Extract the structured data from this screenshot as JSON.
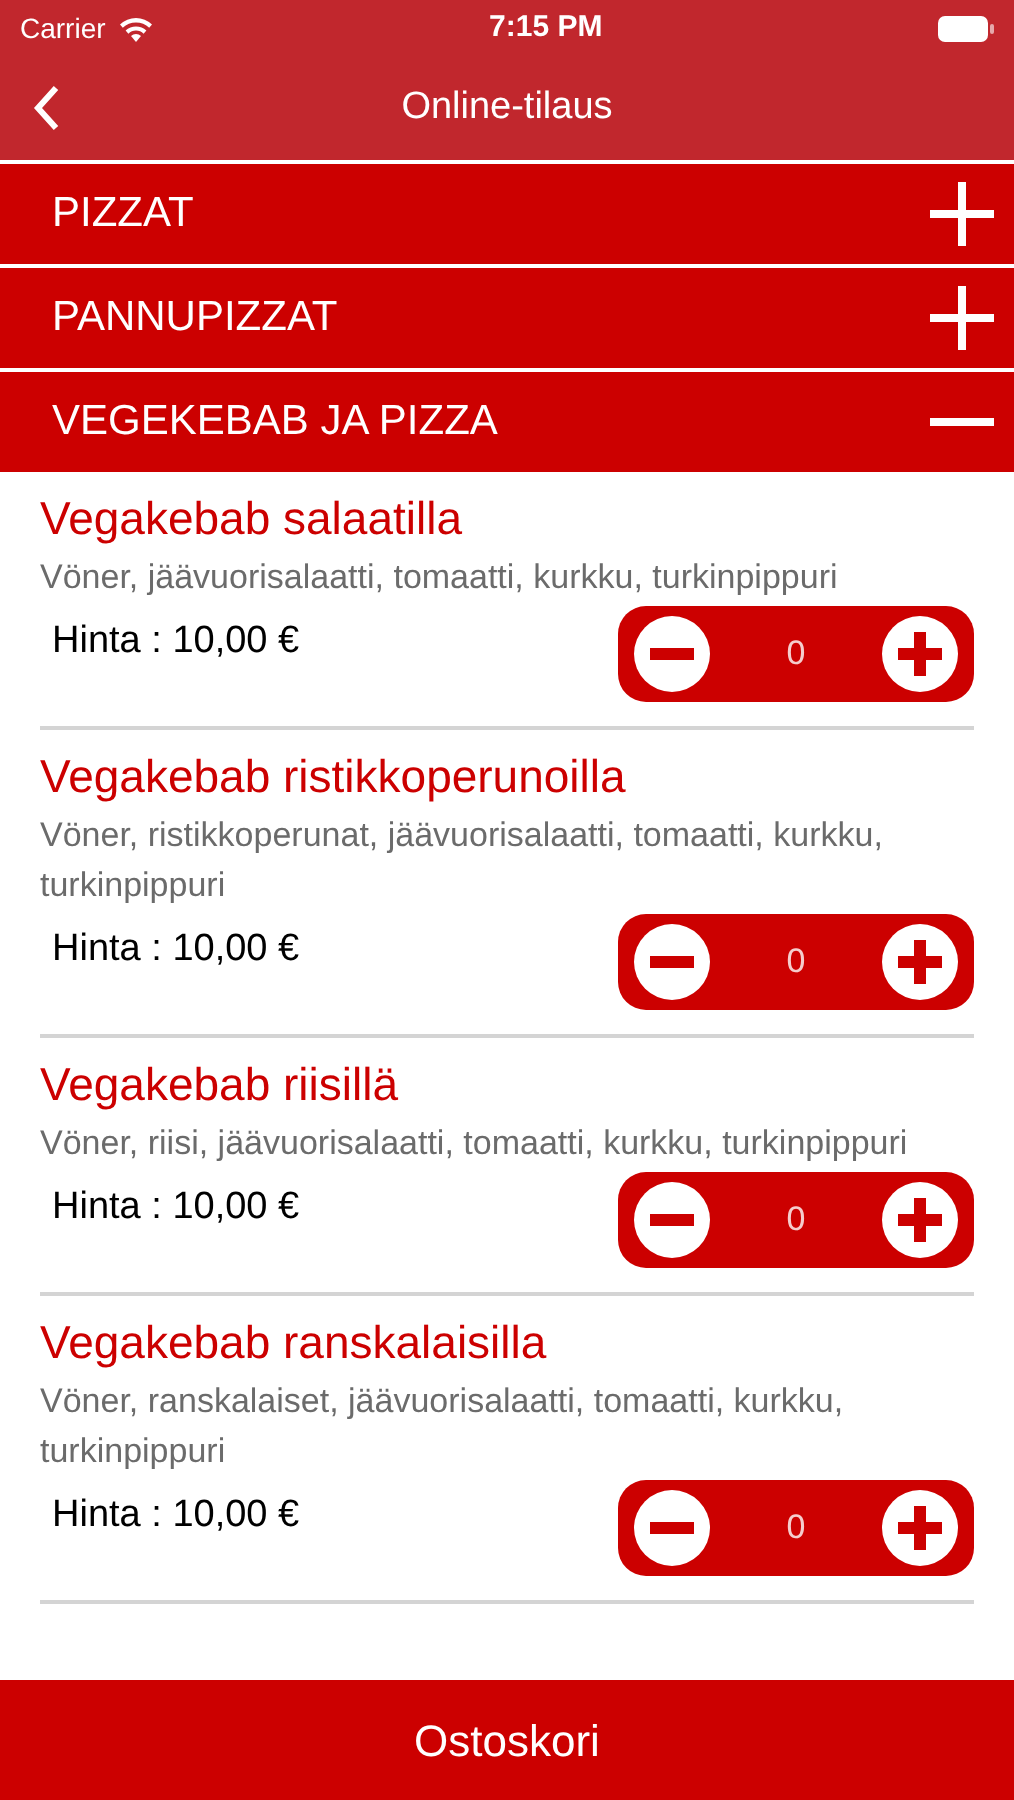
{
  "status_bar": {
    "carrier": "Carrier",
    "time": "7:15 PM"
  },
  "nav": {
    "title": "Online-tilaus"
  },
  "sections": [
    {
      "title": "PIZZAT",
      "expanded": false
    },
    {
      "title": "PANNUPIZZAT",
      "expanded": false
    },
    {
      "title": "VEGEKEBAB JA PIZZA",
      "expanded": true,
      "items": [
        {
          "name": "Vegakebab salaatilla",
          "description": "Vöner, jäävuorisalaatti, tomaatti, kurkku, turkinpippuri",
          "price": "Hinta : 10,00 €",
          "quantity": "0"
        },
        {
          "name": "Vegakebab ristikkoperunoilla",
          "description": "Vöner, ristikkoperunat, jäävuorisalaatti, tomaatti, kurkku, turkinpippuri",
          "price": "Hinta : 10,00 €",
          "quantity": "0"
        },
        {
          "name": "Vegakebab riisillä",
          "description": "Vöner, riisi, jäävuorisalaatti, tomaatti, kurkku, turkinpippuri",
          "price": "Hinta : 10,00 €",
          "quantity": "0"
        },
        {
          "name": "Vegakebab ranskalaisilla",
          "description": "Vöner, ranskalaiset, jäävuorisalaatti, tomaatti, kurkku, turkinpippuri",
          "price": "Hinta : 10,00 €",
          "quantity": "0"
        }
      ]
    }
  ],
  "footer": {
    "label": "Ostoskori"
  }
}
